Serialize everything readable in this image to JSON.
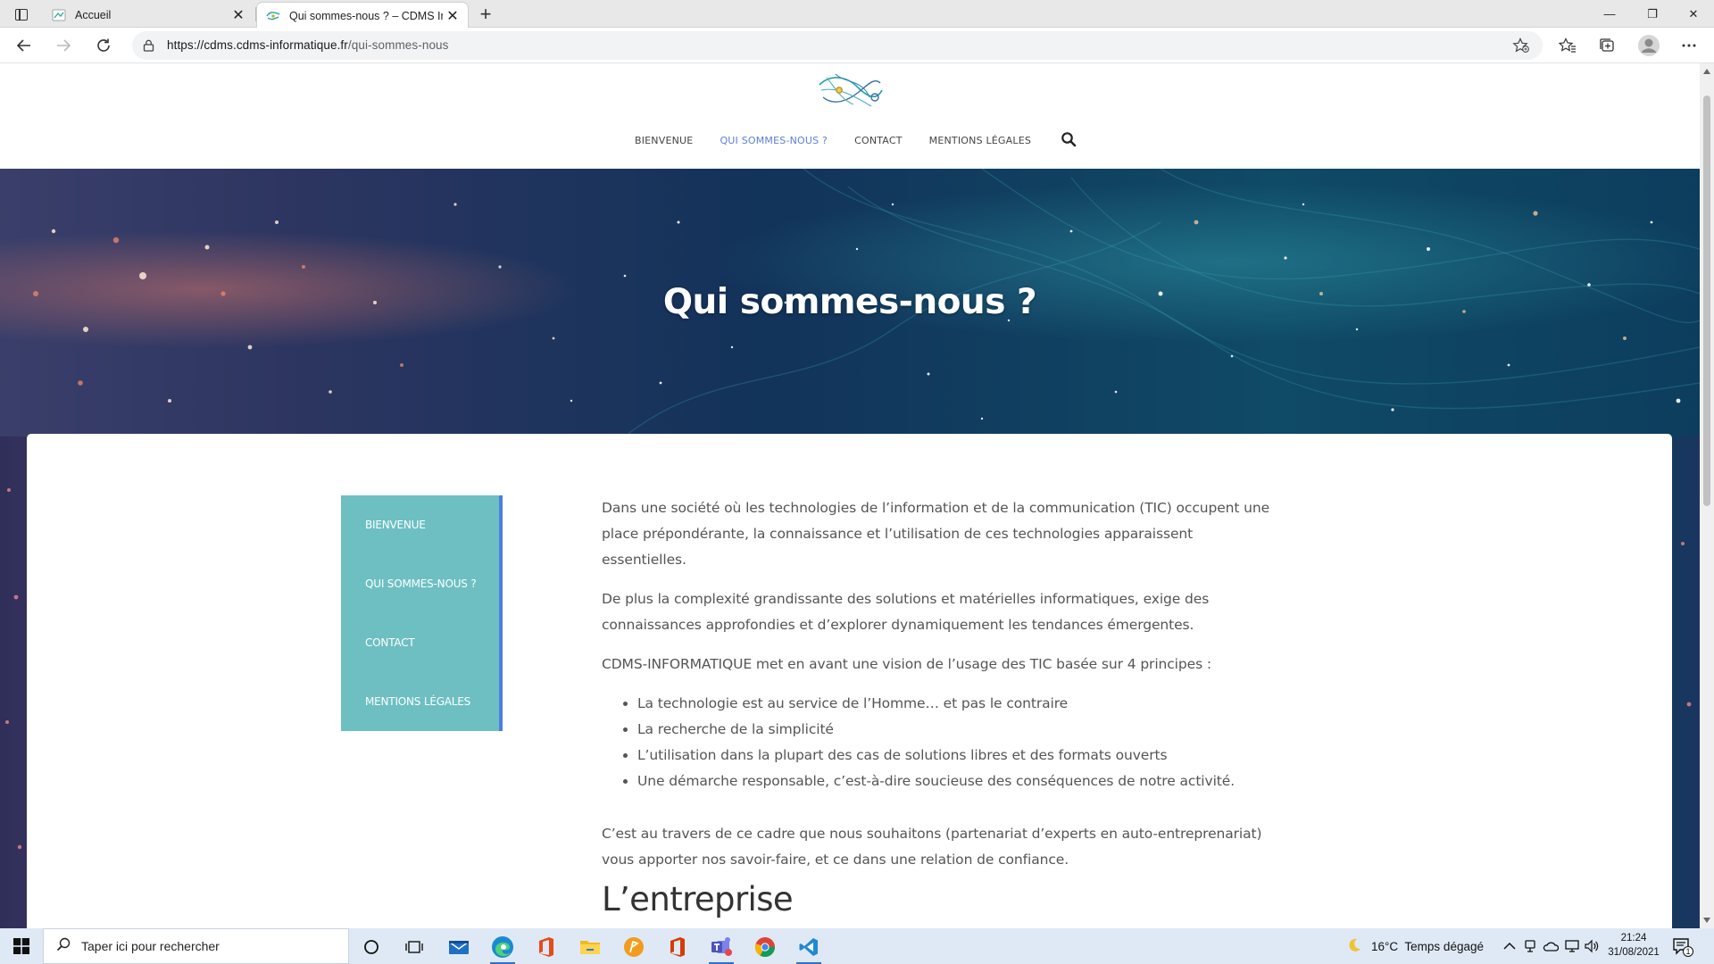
{
  "browser": {
    "tabs": [
      {
        "title": "Accueil",
        "active": false
      },
      {
        "title": "Qui sommes-nous ? – CDMS Informatique",
        "active": true
      }
    ],
    "url": {
      "host": "https://cdms.cdms-informatique.fr",
      "path": "/qui-sommes-nous"
    }
  },
  "site": {
    "nav": [
      "BIENVENUE",
      "QUI SOMMES-NOUS ?",
      "CONTACT",
      "MENTIONS LÉGALES"
    ],
    "current_nav": "QUI SOMMES-NOUS ?",
    "hero_title": "Qui sommes-nous ?",
    "sidebar_menu": [
      "BIENVENUE",
      "QUI SOMMES-NOUS ?",
      "CONTACT",
      "MENTIONS LÉGALES"
    ],
    "article": {
      "p1": "Dans une société où les technologies de l’information et de la communication (TIC) occupent une place prépondérante, la connaissance et l’utilisation de ces technologies apparaissent essentielles.",
      "p2": "De plus la complexité grandissante des solutions et matérielles informatiques, exige des connaissances approfondies et d’explorer dynamiquement les tendances émergentes.",
      "p3": "CDMS-INFORMATIQUE met en avant une vision de l’usage des TIC basée sur 4 principes :",
      "principles": [
        "La technologie est au service de l’Homme… et pas le contraire",
        "La recherche de la simplicité",
        "L’utilisation dans la plupart des cas de solutions libres et des formats ouverts",
        "Une démarche responsable, c’est-à-dire soucieuse des conséquences de notre activité."
      ],
      "p4": "C’est au travers de ce cadre que nous souhaitons (partenariat d’experts en auto-entreprenariat) vous apporter nos savoir-faire, et ce dans une relation de confiance.",
      "h2": "L’entreprise"
    }
  },
  "taskbar": {
    "search_placeholder": "Taper ici pour rechercher",
    "weather": "16°C  Temps dégagé",
    "time": "21:24",
    "date": "31/08/2021",
    "notification_count": "1"
  },
  "colors": {
    "sidebar_bg": "#6dbfc2",
    "sidebar_border": "#4a7fe0",
    "nav_current": "#5b7fd6"
  }
}
